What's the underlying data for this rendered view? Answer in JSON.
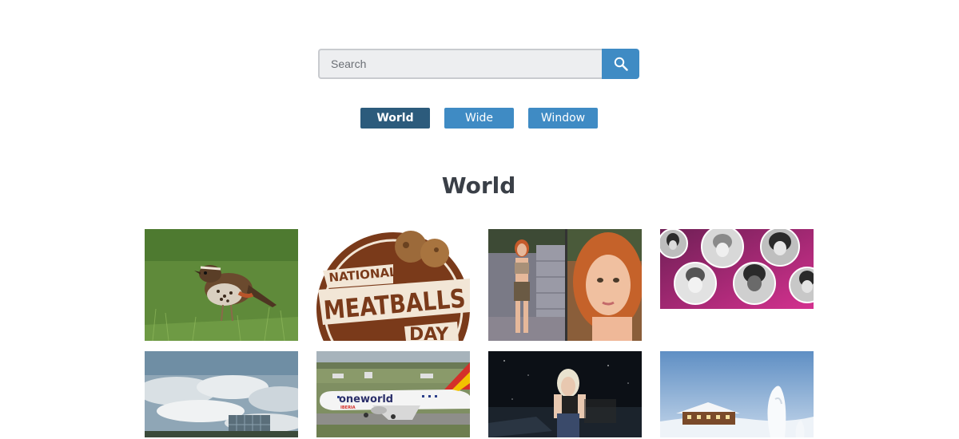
{
  "search": {
    "placeholder": "Search",
    "value": ""
  },
  "tabs": [
    {
      "label": "World",
      "active": true
    },
    {
      "label": "Wide",
      "active": false
    },
    {
      "label": "Window",
      "active": false
    }
  ],
  "section": {
    "title": "World"
  },
  "thumbnails": [
    {
      "subject": "redwing-bird-on-grass"
    },
    {
      "subject": "national-meatballs-day",
      "text": [
        "NATIONAL",
        "MEATBALLS",
        "DAY"
      ]
    },
    {
      "subject": "redhead-avatar-woman"
    },
    {
      "subject": "women-portraits-collage"
    },
    {
      "subject": "cloudy-sky-building"
    },
    {
      "subject": "oneworld-airplane",
      "text": [
        "oneworld",
        "IBERIA"
      ]
    },
    {
      "subject": "night-avatar-woman"
    },
    {
      "subject": "snowy-house-winter"
    }
  ],
  "colors": {
    "accent": "#3f8bc4",
    "active_tab": "#2c5b7c",
    "title": "#3a3f47"
  }
}
